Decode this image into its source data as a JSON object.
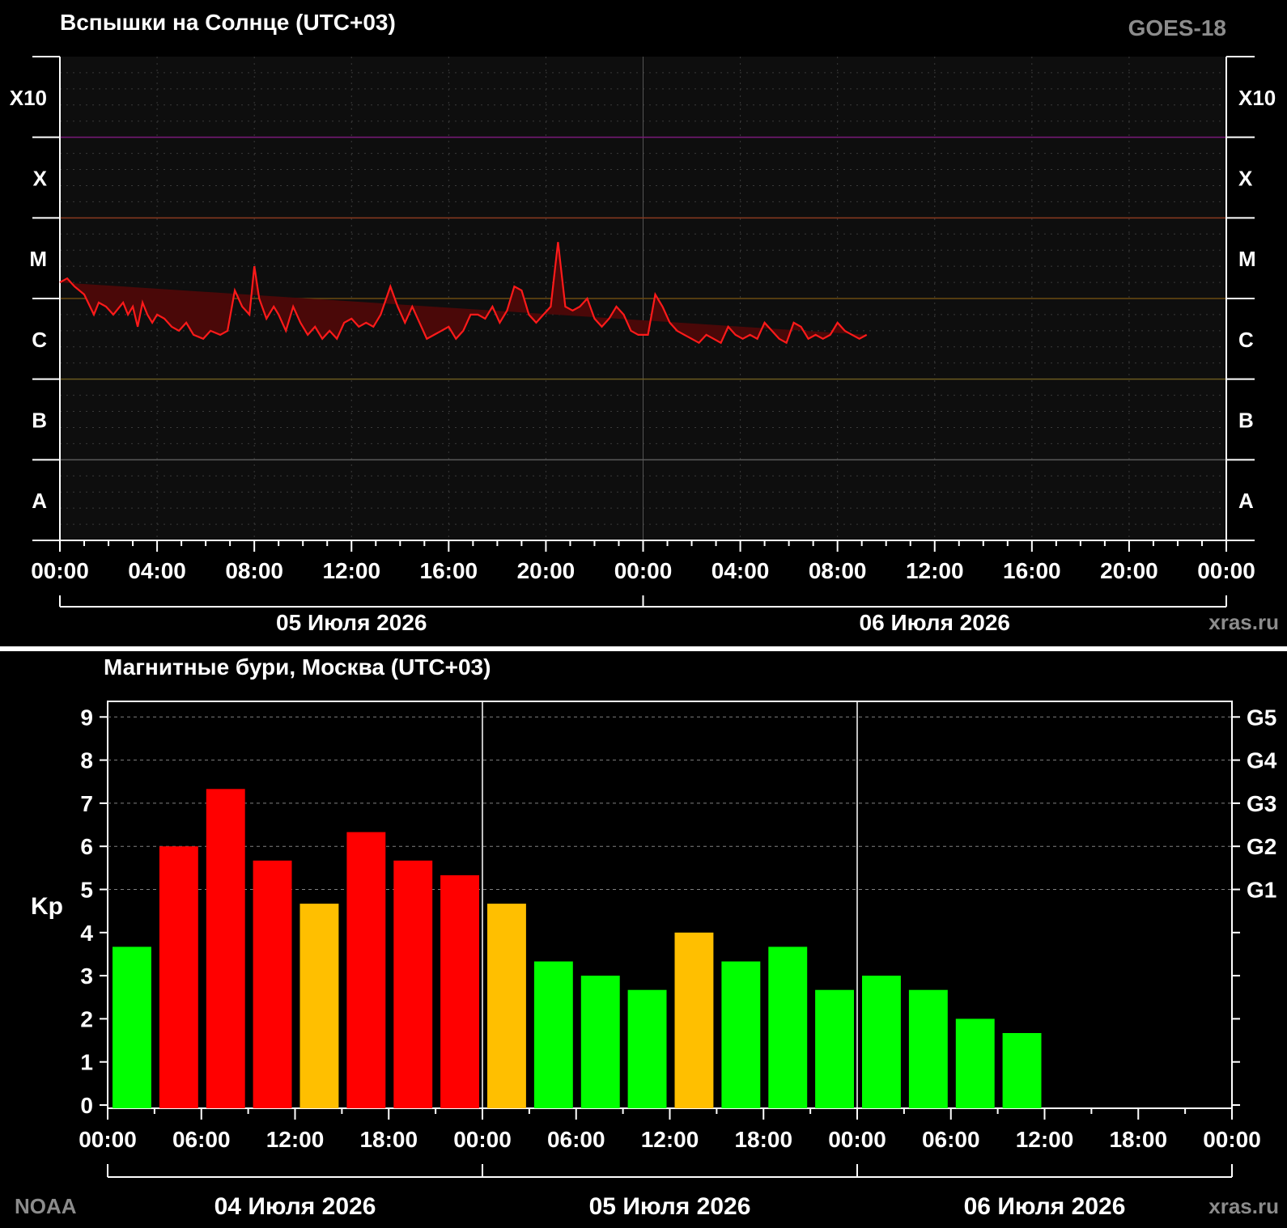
{
  "flares": {
    "title": "Вспышки на Солнце (UTC+03)",
    "satellite": "GOES-18",
    "credit": "xras.ru",
    "colors": {
      "line": "#ff1a1a",
      "fill": "#4a0808",
      "plot_bg": "#0e0e0e",
      "band_x10": "#7a1a7a",
      "band_x": "#8a3a20",
      "band_m": "#6a4a10",
      "band_c": "#6a5a20",
      "band_b": "#5a5a5a"
    }
  },
  "kp": {
    "title": "Магнитные бури, Москва (UTC+03)",
    "ylabel": "Kp",
    "credit_left": "NOAA",
    "credit_right": "xras.ru",
    "colors": {
      "low": "#00ff00",
      "mid": "#ffbf00",
      "high": "#ff0000",
      "grid": "#808080"
    }
  },
  "chart_data": [
    {
      "type": "area",
      "title": "Вспышки на Солнце (UTC+03)",
      "yscale": "log",
      "y_classes": [
        "A",
        "B",
        "C",
        "M",
        "X",
        "X10"
      ],
      "x_ticks": [
        "00:00",
        "04:00",
        "08:00",
        "12:00",
        "16:00",
        "20:00",
        "00:00",
        "04:00",
        "08:00",
        "12:00",
        "16:00",
        "20:00",
        "00:00"
      ],
      "dates": [
        "05 Июля 2026",
        "06 Июля 2026"
      ],
      "xlim_hours": [
        0,
        48
      ],
      "grid": true,
      "series": [
        {
          "x_hours": [
            0.0,
            0.3,
            0.6,
            1.0,
            1.4,
            1.6,
            1.9,
            2.2,
            2.6,
            2.8,
            3.0,
            3.2,
            3.4,
            3.6,
            3.8,
            4.0,
            4.3,
            4.6,
            4.9,
            5.2,
            5.5,
            5.9,
            6.2,
            6.6,
            6.9,
            7.2,
            7.5,
            7.8,
            8.0,
            8.2,
            8.5,
            8.8,
            9.0,
            9.3,
            9.6,
            9.9,
            10.2,
            10.5,
            10.8,
            11.1,
            11.4,
            11.7,
            12.0,
            12.3,
            12.6,
            12.9,
            13.2,
            13.6,
            13.9,
            14.2,
            14.5,
            14.8,
            15.1,
            15.4,
            15.7,
            16.0,
            16.3,
            16.6,
            16.9,
            17.2,
            17.5,
            17.8,
            18.1,
            18.4,
            18.7,
            19.0,
            19.3,
            19.6,
            19.9,
            20.2,
            20.5,
            20.8,
            21.1,
            21.4,
            21.7,
            22.0,
            22.3,
            22.6,
            22.9,
            23.2,
            23.5,
            23.8,
            24.2,
            24.5,
            24.8,
            25.1,
            25.4,
            25.7,
            26.0,
            26.3,
            26.6,
            26.9,
            27.2,
            27.5,
            27.8,
            28.1,
            28.4,
            28.7,
            29.0,
            29.3,
            29.6,
            29.9,
            30.2,
            30.5,
            30.8,
            31.1,
            31.4,
            31.7,
            32.0,
            32.3,
            32.6,
            32.9,
            33.2,
            33.5,
            33.8
          ],
          "y_level": [
            2.8,
            2.75,
            2.85,
            2.95,
            3.2,
            3.05,
            3.1,
            3.2,
            3.05,
            3.2,
            3.1,
            3.35,
            3.05,
            3.2,
            3.3,
            3.2,
            3.25,
            3.35,
            3.4,
            3.3,
            3.45,
            3.5,
            3.4,
            3.45,
            3.4,
            2.9,
            3.1,
            3.2,
            2.6,
            3.0,
            3.25,
            3.1,
            3.2,
            3.4,
            3.1,
            3.3,
            3.45,
            3.35,
            3.5,
            3.4,
            3.5,
            3.3,
            3.25,
            3.35,
            3.3,
            3.35,
            3.2,
            2.85,
            3.1,
            3.3,
            3.1,
            3.3,
            3.5,
            3.45,
            3.4,
            3.35,
            3.5,
            3.4,
            3.2,
            3.2,
            3.25,
            3.1,
            3.3,
            3.15,
            2.85,
            2.9,
            3.2,
            3.3,
            3.2,
            3.1,
            2.3,
            3.1,
            3.15,
            3.1,
            3.0,
            3.25,
            3.35,
            3.25,
            3.1,
            3.2,
            3.4,
            3.45,
            3.45,
            2.95,
            3.1,
            3.3,
            3.4,
            3.45,
            3.5,
            3.55,
            3.45,
            3.5,
            3.55,
            3.35,
            3.45,
            3.5,
            3.45,
            3.5,
            3.3,
            3.4,
            3.5,
            3.55,
            3.3,
            3.35,
            3.5,
            3.45,
            3.5,
            3.45,
            3.3,
            3.4,
            3.45,
            3.5,
            3.45
          ]
        }
      ]
    },
    {
      "type": "bar",
      "title": "Магнитные бури, Москва (UTC+03)",
      "ylabel": "Kp",
      "ylim": [
        0,
        9
      ],
      "y_ticks": [
        0,
        1,
        2,
        3,
        4,
        5,
        6,
        7,
        8,
        9
      ],
      "g_scale": [
        "G1",
        "G2",
        "G3",
        "G4",
        "G5"
      ],
      "x_ticks": [
        "00:00",
        "06:00",
        "12:00",
        "18:00",
        "00:00",
        "06:00",
        "12:00",
        "18:00",
        "00:00",
        "06:00",
        "12:00",
        "18:00",
        "00:00"
      ],
      "dates": [
        "04 Июля 2026",
        "05 Июля 2026",
        "06 Июля 2026"
      ],
      "bar_interval_hours": 3,
      "values": [
        3.67,
        6.0,
        7.33,
        5.67,
        4.67,
        6.33,
        5.67,
        5.33,
        4.67,
        3.33,
        3.0,
        2.67,
        4.0,
        3.33,
        3.67,
        2.67,
        3.0,
        2.67,
        2.0,
        1.67
      ],
      "grid": true
    }
  ]
}
